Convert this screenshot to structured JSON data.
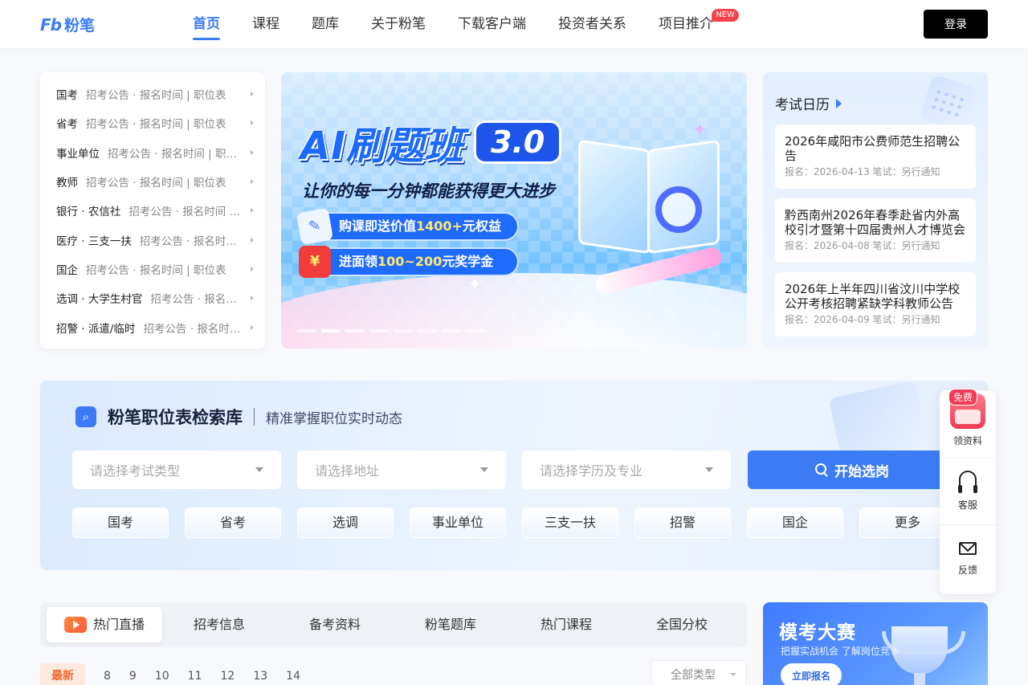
{
  "header": {
    "logo_mark": "Fb",
    "logo_text": "粉笔",
    "nav": [
      {
        "label": "首页",
        "active": true
      },
      {
        "label": "课程"
      },
      {
        "label": "题库"
      },
      {
        "label": "关于粉笔"
      },
      {
        "label": "下载客户端"
      },
      {
        "label": "投资者关系"
      },
      {
        "label": "项目推介",
        "badge": "NEW"
      }
    ],
    "login_label": "登录"
  },
  "categories": [
    {
      "name": "国考",
      "sub": "招考公告 · 报名时间 | 职位表"
    },
    {
      "name": "省考",
      "sub": "招考公告 · 报名时间 | 职位表"
    },
    {
      "name": "事业单位",
      "sub": "招考公告 · 报名时间 | 职位表"
    },
    {
      "name": "教师",
      "sub": "招考公告 · 报名时间 | 职位表"
    },
    {
      "name": "银行 · 农信社",
      "sub": "招考公告 · 报名时间 | 职位表"
    },
    {
      "name": "医疗 · 三支一扶",
      "sub": "招考公告 · 报名时间 | 职位表"
    },
    {
      "name": "国企",
      "sub": "招考公告 · 报名时间 | 职位表"
    },
    {
      "name": "选调 · 大学生村官",
      "sub": "招考公告 · 报名时间 | 职位表"
    },
    {
      "name": "招警 · 派遣/临时",
      "sub": "招考公告 · 报名时间 | 职位表"
    }
  ],
  "banner": {
    "title": "AI刷题班",
    "version": "3.0",
    "slogan": "让你的每一分钟都能获得更大进步",
    "chip1_pre": "购课即送价值",
    "chip1_hl": "1400+",
    "chip1_post": "元权益",
    "chip2_pre": "进面领",
    "chip2_hl": "100~200",
    "chip2_post": "元奖学金"
  },
  "calendar": {
    "title": "考试日历",
    "items": [
      {
        "title": "2026年咸阳市公费师范生招聘公告",
        "meta": "报名：2026-04-13  笔试：另行通知"
      },
      {
        "title": "黔西南州2026年春季赴省内外高校引才暨第十四届贵州人才博览会",
        "meta": "报名：2026-04-08  笔试：另行通知"
      },
      {
        "title": "2026年上半年四川省汶川中学校公开考核招聘紧缺学科教师公告",
        "meta": "报名：2026-04-09  笔试：另行通知"
      }
    ]
  },
  "search": {
    "title": "粉笔职位表检索库",
    "subtitle": "精准掌握职位实时动态",
    "selects": [
      "请选择考试类型",
      "请选择地址",
      "请选择学历及专业"
    ],
    "button_label": "开始选岗",
    "tags": [
      "国考",
      "省考",
      "选调",
      "事业单位",
      "三支一扶",
      "招警",
      "国企",
      "更多"
    ]
  },
  "side_float": {
    "items": [
      {
        "label": "领资料",
        "badge": "免费"
      },
      {
        "label": "客服"
      },
      {
        "label": "反馈"
      }
    ]
  },
  "tabs": [
    "热门直播",
    "招考信息",
    "备考资料",
    "粉笔题库",
    "热门课程",
    "全国分校"
  ],
  "dates": [
    "最新",
    "8",
    "9",
    "10",
    "11",
    "12",
    "13",
    "14"
  ],
  "type_filter": "全部类型",
  "contest": {
    "title": "模考大赛",
    "subtitle": "把握实战机会 了解岗位竞争",
    "button": "立即报名"
  },
  "colors": {
    "brand": "#3b7cf6",
    "badge": "#f4434a",
    "live_accent": "#f1682f"
  }
}
